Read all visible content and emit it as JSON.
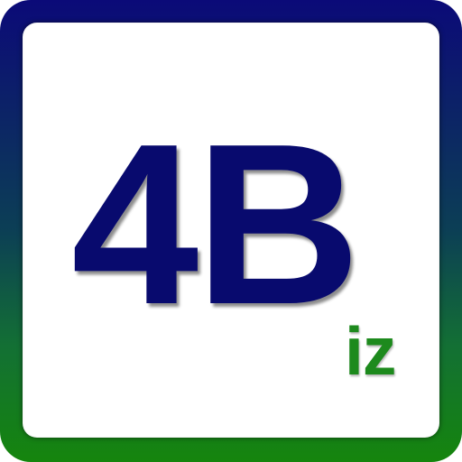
{
  "logo": {
    "main_text": "4B",
    "sub_text": "iz",
    "main_color": "#080a6e",
    "sub_color": "#1d8a1d",
    "frame_gradient": [
      "#0b0a78",
      "#15850d"
    ],
    "background_color": "#ffffff"
  }
}
